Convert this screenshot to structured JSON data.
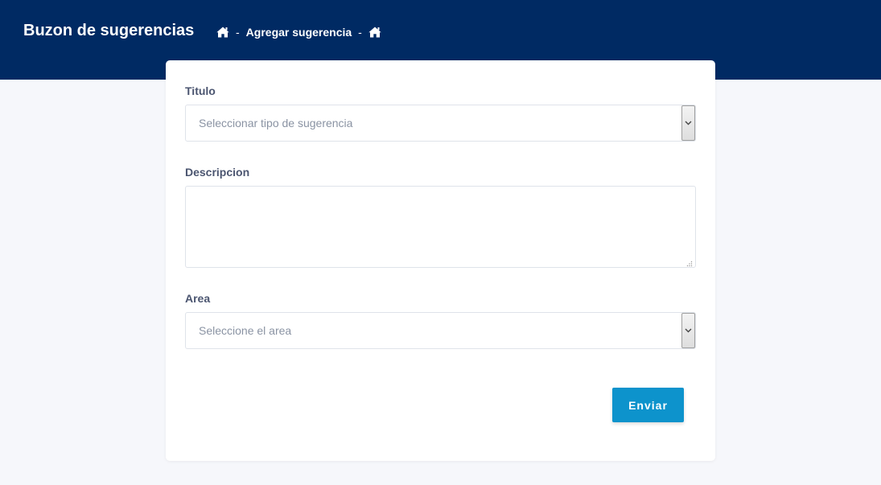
{
  "header": {
    "title": "Buzon de sugerencias",
    "breadcrumb": {
      "home_icon": "home-icon",
      "separator": "-",
      "current": "Agregar sugerencia",
      "end_icon": "home-icon"
    },
    "background_color": "#002a63"
  },
  "form": {
    "titulo": {
      "label": "Titulo",
      "placeholder": "Seleccionar tipo de sugerencia"
    },
    "descripcion": {
      "label": "Descripcion",
      "value": ""
    },
    "area": {
      "label": "Area",
      "placeholder": "Seleccione el area"
    },
    "submit_label": "Enviar",
    "submit_color": "#0d93cc"
  }
}
